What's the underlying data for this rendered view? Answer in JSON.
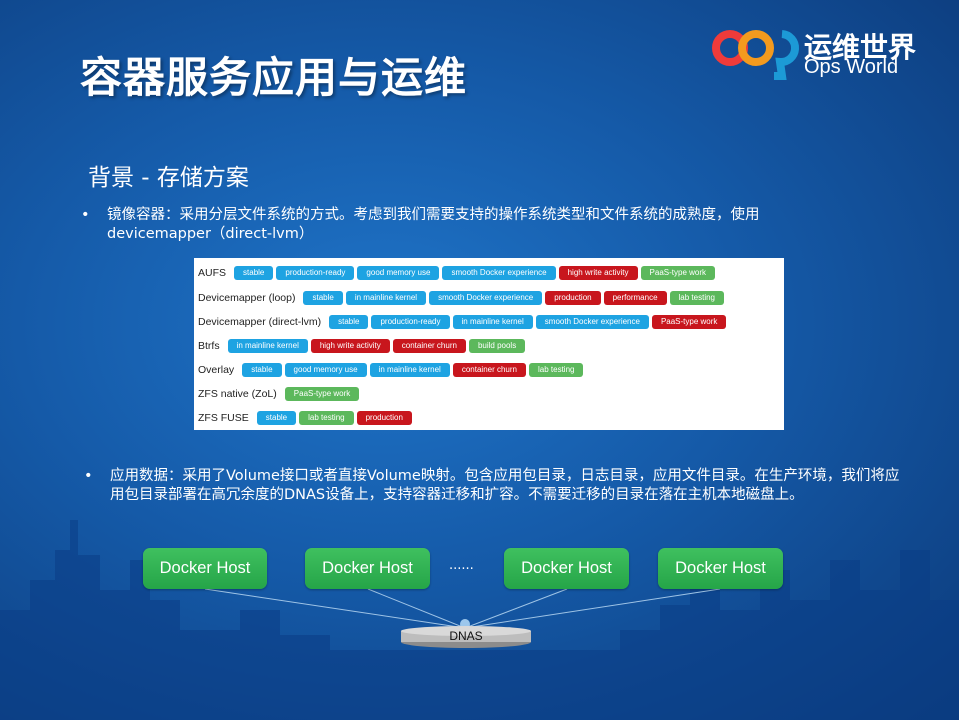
{
  "slide": {
    "title": "容器服务应用与运维",
    "subtitle": "背景 - 存储方案",
    "bullet_char": "•"
  },
  "logo": {
    "cn": "运维世界",
    "en": "Ops World"
  },
  "bullets": [
    "镜像容器：采用分层文件系统的方式。考虑到我们需要支持的操作系统类型和文件系统的成熟度，使用devicemapper（direct-lvm）",
    "应用数据：采用了Volume接口或者直接Volume映射。包含应用包目录，日志目录，应用文件目录。在生产环境，我们将应用包目录部署在高冗余度的DNAS设备上，支持容器迁移和扩容。不需要迁移的目录在落在主机本地磁盘上。"
  ],
  "storage_table": [
    {
      "name": "AUFS",
      "tags": [
        {
          "label": "stable",
          "color": "blue"
        },
        {
          "label": "production-ready",
          "color": "blue"
        },
        {
          "label": "good memory use",
          "color": "blue"
        },
        {
          "label": "smooth Docker experience",
          "color": "blue"
        },
        {
          "label": "high write activity",
          "color": "red"
        },
        {
          "label": "PaaS-type work",
          "color": "green"
        }
      ]
    },
    {
      "name": "Devicemapper (loop)",
      "tags": [
        {
          "label": "stable",
          "color": "blue"
        },
        {
          "label": "in mainline kernel",
          "color": "blue"
        },
        {
          "label": "smooth Docker experience",
          "color": "blue"
        },
        {
          "label": "production",
          "color": "red"
        },
        {
          "label": "performance",
          "color": "red"
        },
        {
          "label": "lab testing",
          "color": "green"
        }
      ]
    },
    {
      "name": "Devicemapper (direct-lvm)",
      "tags": [
        {
          "label": "stable",
          "color": "blue"
        },
        {
          "label": "production-ready",
          "color": "blue"
        },
        {
          "label": "in mainline kernel",
          "color": "blue"
        },
        {
          "label": "smooth Docker experience",
          "color": "blue"
        },
        {
          "label": "PaaS-type work",
          "color": "red"
        }
      ]
    },
    {
      "name": "Btrfs",
      "tags": [
        {
          "label": "in mainline kernel",
          "color": "blue"
        },
        {
          "label": "high write activity",
          "color": "red"
        },
        {
          "label": "container churn",
          "color": "red"
        },
        {
          "label": "build pools",
          "color": "green"
        }
      ]
    },
    {
      "name": "Overlay",
      "tags": [
        {
          "label": "stable",
          "color": "blue"
        },
        {
          "label": "good memory use",
          "color": "blue"
        },
        {
          "label": "in mainline kernel",
          "color": "blue"
        },
        {
          "label": "container churn",
          "color": "red"
        },
        {
          "label": "lab testing",
          "color": "green"
        }
      ]
    },
    {
      "name": "ZFS native (ZoL)",
      "tags": [
        {
          "label": "PaaS-type work",
          "color": "green"
        }
      ]
    },
    {
      "name": "ZFS FUSE",
      "tags": [
        {
          "label": "stable",
          "color": "blue"
        },
        {
          "label": "lab testing",
          "color": "green"
        },
        {
          "label": "production",
          "color": "red"
        }
      ]
    }
  ],
  "diagram": {
    "hosts": [
      "Docker Host",
      "Docker Host",
      "Docker Host",
      "Docker Host"
    ],
    "ellipsis": "......",
    "storage": "DNAS"
  },
  "colors": {
    "blue_tag": "#1ea3e2",
    "red_tag": "#c8161d",
    "green_tag": "#5cb85c",
    "host_green": "#2db34f"
  }
}
